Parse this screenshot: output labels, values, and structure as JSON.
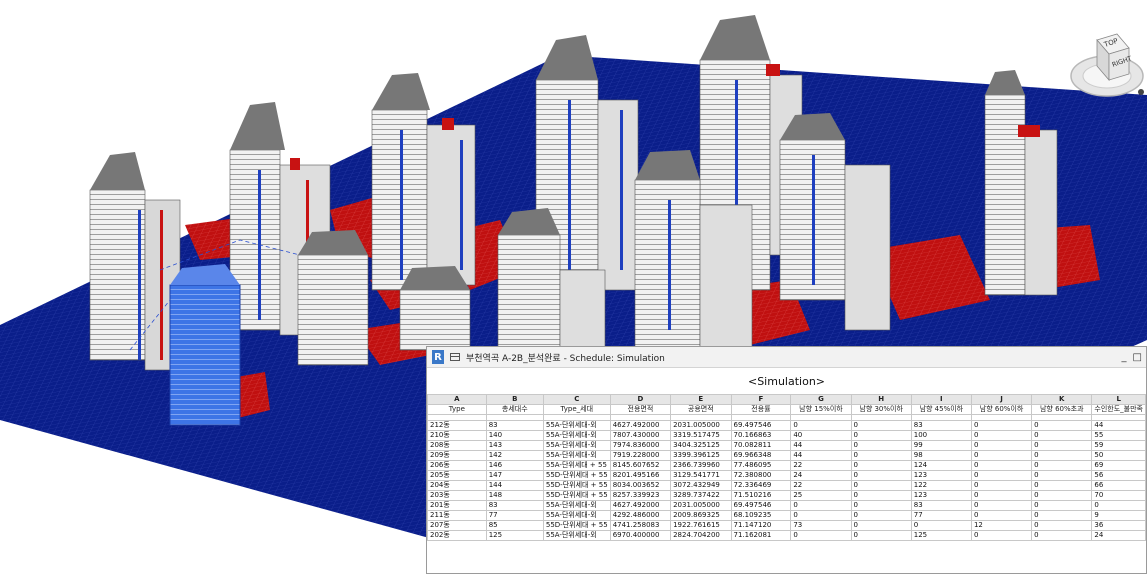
{
  "viewcube": {
    "top_label": "TOP",
    "right_label": "RIGHT"
  },
  "schedule_window": {
    "title": "부천역곡 A-2B_분석완료 - Schedule: Simulation",
    "minimize": "_",
    "maximize": "□"
  },
  "schedule": {
    "title": "<Simulation>",
    "column_letters": [
      "A",
      "B",
      "C",
      "D",
      "E",
      "F",
      "G",
      "H",
      "I",
      "J",
      "K",
      "L"
    ],
    "column_names": [
      "Type",
      "총세대수",
      "Type_세대",
      "전용면적",
      "공용면적",
      "전용률",
      "남향 15%이하",
      "남향 30%이하",
      "남향 45%이하",
      "남향 60%이하",
      "남향 60%초과",
      "수인한도_불만족"
    ],
    "rows": [
      [
        "212동",
        "83",
        "55A-단위세대-외",
        "4627.492000",
        "2031.005000",
        "69.497546",
        "0",
        "0",
        "83",
        "0",
        "0",
        "44"
      ],
      [
        "210동",
        "140",
        "55A-단위세대-외",
        "7807.430000",
        "3319.517475",
        "70.166863",
        "40",
        "0",
        "100",
        "0",
        "0",
        "55"
      ],
      [
        "208동",
        "143",
        "55A-단위세대-외",
        "7974.836000",
        "3404.325125",
        "70.082811",
        "44",
        "0",
        "99",
        "0",
        "0",
        "59"
      ],
      [
        "209동",
        "142",
        "55A-단위세대-외",
        "7919.228000",
        "3399.396125",
        "69.966348",
        "44",
        "0",
        "98",
        "0",
        "0",
        "50"
      ],
      [
        "206동",
        "146",
        "55A-단위세대 + 55",
        "8145.607652",
        "2366.739960",
        "77.486095",
        "22",
        "0",
        "124",
        "0",
        "0",
        "69"
      ],
      [
        "205동",
        "147",
        "55D-단위세대 + 55",
        "8201.495166",
        "3129.541771",
        "72.380800",
        "24",
        "0",
        "123",
        "0",
        "0",
        "56"
      ],
      [
        "204동",
        "144",
        "55D-단위세대 + 55",
        "8034.003652",
        "3072.432949",
        "72.336469",
        "22",
        "0",
        "122",
        "0",
        "0",
        "66"
      ],
      [
        "203동",
        "148",
        "55D-단위세대 + 55",
        "8257.339923",
        "3289.737422",
        "71.510216",
        "25",
        "0",
        "123",
        "0",
        "0",
        "70"
      ],
      [
        "201동",
        "83",
        "55A-단위세대-외",
        "4627.492000",
        "2031.005000",
        "69.497546",
        "0",
        "0",
        "83",
        "0",
        "0",
        "0"
      ],
      [
        "211동",
        "77",
        "55A-단위세대-외",
        "4292.486000",
        "2009.869325",
        "68.109235",
        "0",
        "0",
        "77",
        "0",
        "0",
        "9"
      ],
      [
        "207동",
        "85",
        "55D-단위세대 + 55",
        "4741.258083",
        "1922.761615",
        "71.147120",
        "73",
        "0",
        "0",
        "12",
        "0",
        "36"
      ],
      [
        "202동",
        "125",
        "55A-단위세대-외",
        "6970.400000",
        "2824.704200",
        "71.162081",
        "0",
        "0",
        "125",
        "0",
        "0",
        "24"
      ]
    ]
  },
  "colors": {
    "grid_blue": "#0b1f8c",
    "shadow_red": "#c81212",
    "building_white": "#f2f2f2",
    "selection_blue": "#3a6fe0"
  }
}
